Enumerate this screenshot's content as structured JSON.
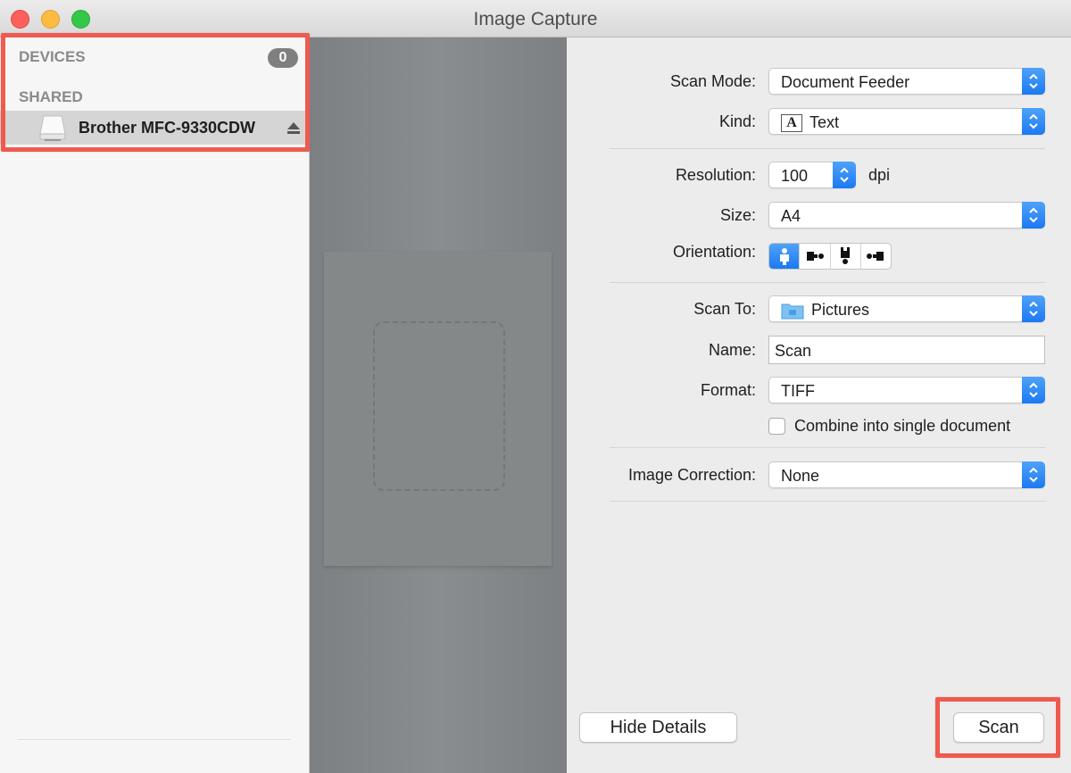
{
  "window": {
    "title": "Image Capture"
  },
  "sidebar": {
    "devices_header": "DEVICES",
    "devices_count": "0",
    "shared_header": "SHARED",
    "shared_device": {
      "name": "Brother MFC-9330CDW",
      "icon": "printer-icon",
      "action_icon": "eject-icon"
    }
  },
  "details": {
    "scan_mode": {
      "label": "Scan Mode:",
      "value": "Document Feeder"
    },
    "kind": {
      "label": "Kind:",
      "value": "Text",
      "icon": "text-kind-icon"
    },
    "resolution": {
      "label": "Resolution:",
      "value": "100",
      "unit": "dpi"
    },
    "size": {
      "label": "Size:",
      "value": "A4"
    },
    "orientation": {
      "label": "Orientation:",
      "options": [
        "portrait-upright",
        "landscape-right",
        "portrait-inverted",
        "landscape-left"
      ],
      "selected": "portrait-upright"
    },
    "scan_to": {
      "label": "Scan To:",
      "value": "Pictures",
      "icon": "folder-icon"
    },
    "name": {
      "label": "Name:",
      "value": "Scan"
    },
    "format": {
      "label": "Format:",
      "value": "TIFF"
    },
    "combine": {
      "label": "Combine into single document",
      "checked": false
    },
    "image_correction": {
      "label": "Image Correction:",
      "value": "None"
    }
  },
  "buttons": {
    "hide_details": "Hide Details",
    "scan": "Scan"
  },
  "colors": {
    "accent": "#1c79f2",
    "highlight": "#ef5a4f",
    "close": "#fc605c",
    "minimize": "#fdbc40",
    "maximize": "#34c84a"
  }
}
